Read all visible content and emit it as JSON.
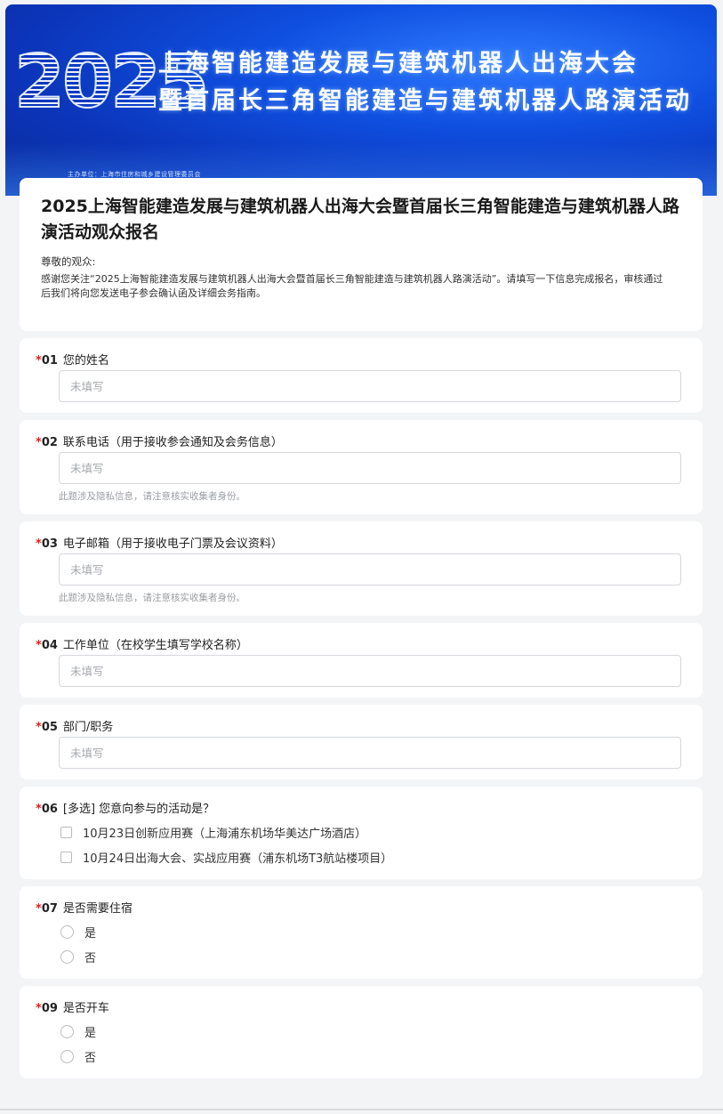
{
  "banner": {
    "year": "2025",
    "line1": "上海智能建造发展与建筑机器人出海大会",
    "line2": "暨首届长三角智能建造与建筑机器人路演活动",
    "host": "主办单位：上海市住房和城乡建设管理委员会"
  },
  "header": {
    "title": "2025上海智能建造发展与建筑机器人出海大会暨首届长三角智能建造与建筑机器人路演活动观众报名",
    "greeting": "尊敬的观众:",
    "intro": "感谢您关注“2025上海智能建造发展与建筑机器人出海大会暨首届长三角智能建造与建筑机器人路演活动”。请填写一下信息完成报名，审核通过后我们将向您发送电子参会确认函及详细会务指南。"
  },
  "form": {
    "required_mark": "*",
    "placeholder": "未填写",
    "privacy_note": "此题涉及隐私信息，请注意核实收集者身份。",
    "q1": {
      "num": "01",
      "title": "您的姓名"
    },
    "q2": {
      "num": "02",
      "title": "联系电话（用于接收参会通知及会务信息）"
    },
    "q3": {
      "num": "03",
      "title": "电子邮箱（用于接收电子门票及会议资料）"
    },
    "q4": {
      "num": "04",
      "title": "工作单位（在校学生填写学校名称）"
    },
    "q5": {
      "num": "05",
      "title": "部门/职务"
    },
    "q6": {
      "num": "06",
      "title": "[多选] 您意向参与的活动是？",
      "options": [
        "10月23日创新应用赛（上海浦东机场华美达广场酒店）",
        "10月24日出海大会、实战应用赛（浦东机场T3航站楼项目）"
      ]
    },
    "q7": {
      "num": "07",
      "title": "是否需要住宿",
      "options": [
        "是",
        "否"
      ]
    },
    "q9": {
      "num": "09",
      "title": "是否开车",
      "options": [
        "是",
        "否"
      ]
    }
  }
}
